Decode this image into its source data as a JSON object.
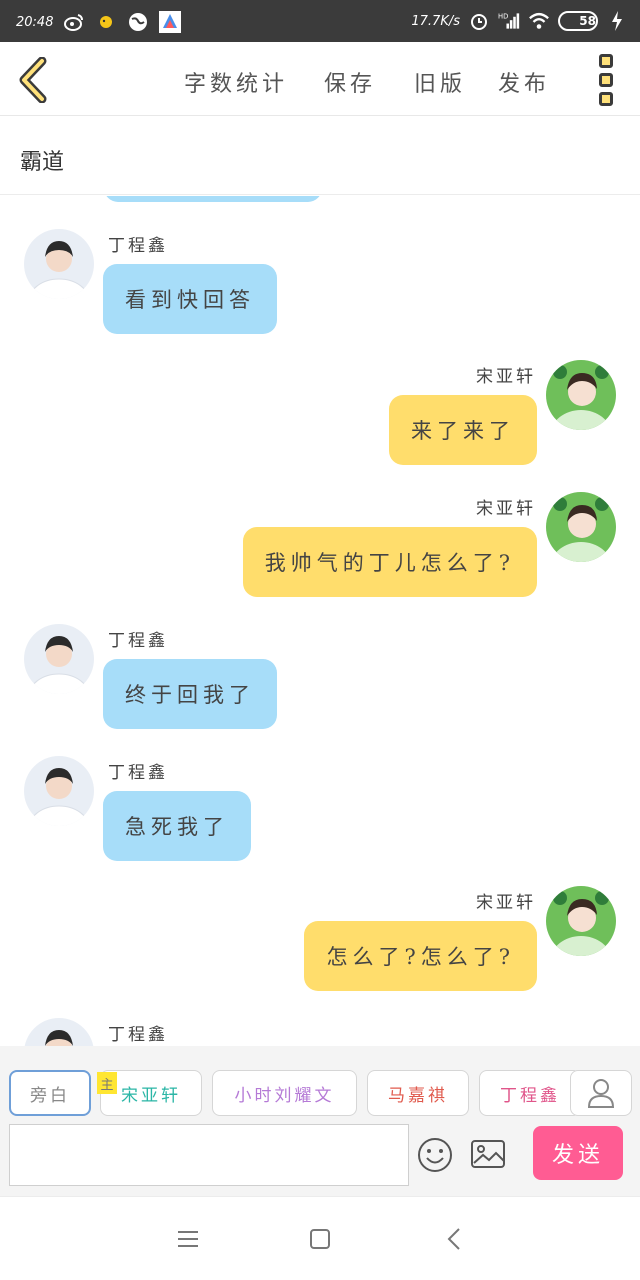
{
  "status_bar": {
    "time": "20:48",
    "net_speed": "17.7K/s",
    "network": "HD",
    "battery_level": "58"
  },
  "toolbar": {
    "word_count": "字数统计",
    "save": "保存",
    "old_version": "旧版",
    "publish": "发布"
  },
  "title": "霸道",
  "messages": [
    {
      "side": "left",
      "speaker": "丁程鑫",
      "text": "看到快回答",
      "color": "#a7ddf9"
    },
    {
      "side": "right",
      "speaker": "宋亚轩",
      "text": "来了来了",
      "color": "#ffdd6c"
    },
    {
      "side": "right",
      "speaker": "宋亚轩",
      "text": "我帅气的丁儿怎么了?",
      "color": "#ffdd6c"
    },
    {
      "side": "left",
      "speaker": "丁程鑫",
      "text": "终于回我了",
      "color": "#a7ddf9"
    },
    {
      "side": "left",
      "speaker": "丁程鑫",
      "text": "急死我了",
      "color": "#a7ddf9"
    },
    {
      "side": "right",
      "speaker": "宋亚轩",
      "text": "怎么了?怎么了?",
      "color": "#ffdd6c"
    },
    {
      "side": "left",
      "speaker": "丁程鑫",
      "text": "",
      "color": "#a7ddf9"
    }
  ],
  "roles": {
    "narration": "旁白",
    "main_tag": "主",
    "items": [
      {
        "label": "宋亚轩",
        "color": "#2bb6a6"
      },
      {
        "label": "小时刘耀文",
        "color": "#b57ad6"
      },
      {
        "label": "马嘉祺",
        "color": "#e05a4d"
      },
      {
        "label": "丁程鑫",
        "color": "#e0558a"
      }
    ]
  },
  "input": {
    "placeholder": "",
    "send_label": "发送"
  }
}
